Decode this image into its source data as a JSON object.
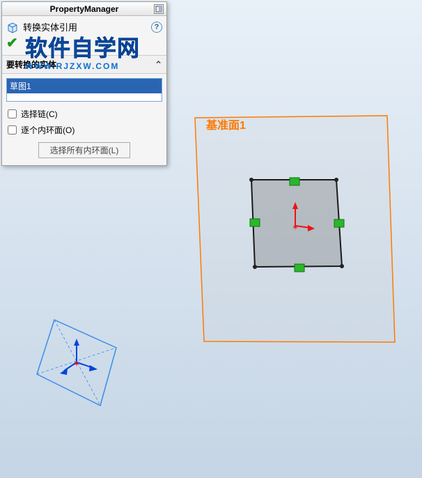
{
  "panel": {
    "header_title": "PropertyManager",
    "title": "转换实体引用",
    "help_symbol": "?"
  },
  "section": {
    "header": "要转换的实体",
    "caret": "⌃",
    "selected_item": "草图1",
    "chain_label": "选择链(C)",
    "inner_faces_label": "逐个内环面(O)",
    "inner_loops_button": "选择所有内环面(L)"
  },
  "watermark": {
    "main": "软件自学网",
    "sub": "WWW.RJZXW.COM"
  },
  "scene": {
    "plane_label": "基准面1"
  }
}
